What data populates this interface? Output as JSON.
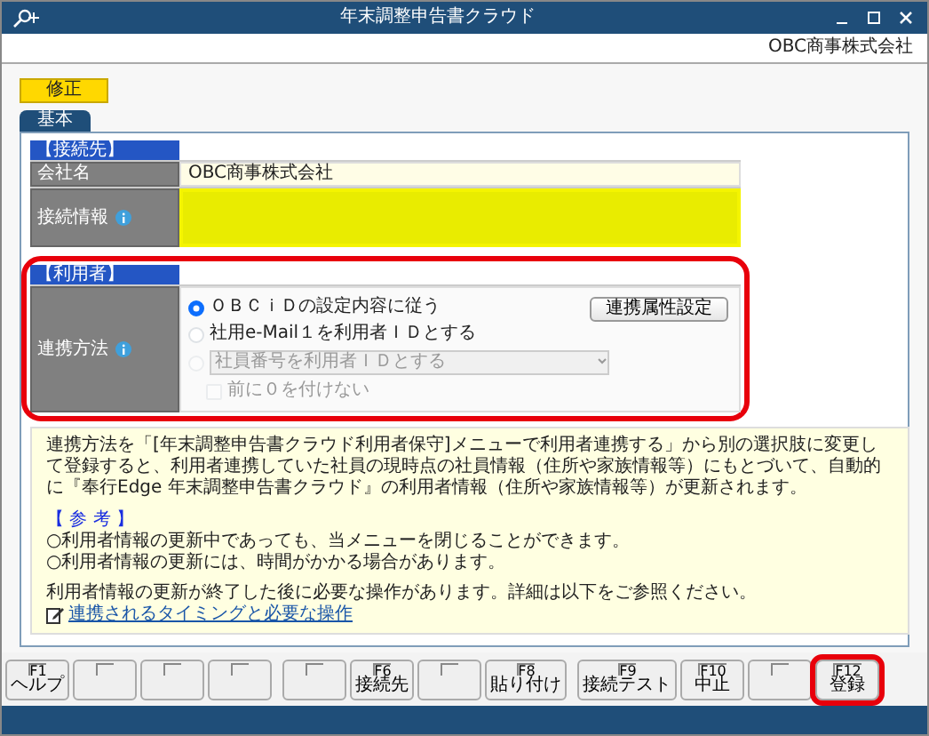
{
  "window": {
    "title": "年末調整申告書クラウド"
  },
  "company": "OBC商事株式会社",
  "mode_badge": "修正",
  "tabs": [
    {
      "label": "基本",
      "selected": true
    }
  ],
  "sections": [
    {
      "heading": "【接続先】",
      "highlighted": false,
      "rows": [
        {
          "kind": "text",
          "label": "会社名",
          "value": "OBC商事株式会社"
        },
        {
          "kind": "masked",
          "label": "接続情報",
          "info": true
        }
      ]
    },
    {
      "heading": "【利用者】",
      "highlighted": true,
      "rows": [
        {
          "kind": "options",
          "label": "連携方法",
          "info": true,
          "button": "連携属性設定",
          "options": [
            {
              "kind": "radio",
              "label": "ＯＢＣｉＤの設定内容に従う",
              "selected": true,
              "disabled": false
            },
            {
              "kind": "radio",
              "label": "社用e-Mail１を利用者ＩＤとする",
              "selected": false,
              "disabled": false
            },
            {
              "kind": "select",
              "label": "社員番号を利用者ＩＤとする",
              "selected": false,
              "disabled": true
            }
          ],
          "checkbox": {
            "label": "前に０を付けない",
            "checked": false,
            "disabled": true
          }
        }
      ]
    }
  ],
  "note": {
    "paragraph": "連携方法を「[年末調整申告書クラウド利用者保守]メニューで利用者連携する」から別の選択肢に変更して登録すると、利用者連携していた社員の現時点の社員情報（住所や家族情報等）にもとづいて、自動的に『奉行Edge 年末調整申告書クラウド』の利用者情報（住所や家族情報等）が更新されます。",
    "reference_heading": "【 参 考 】",
    "reference_items": [
      "○利用者情報の更新中であっても、当メニューを閉じることができます。",
      "○利用者情報の更新には、時間がかかる場合があります。"
    ],
    "closing": "利用者情報の更新が終了した後に必要な操作があります。詳細は以下をご参照ください。",
    "link": "連携されるタイミングと必要な操作"
  },
  "function_key_groups": [
    [
      {
        "key": "F1",
        "label": "ヘルプ",
        "highlighted": false
      },
      {
        "highlighted": false
      },
      {
        "highlighted": false
      },
      {
        "highlighted": false
      }
    ],
    [
      {
        "highlighted": false
      },
      {
        "key": "F6",
        "label": "接続先",
        "highlighted": false
      },
      {
        "highlighted": false
      },
      {
        "key": "F8",
        "label": "貼り付け",
        "highlighted": false
      }
    ],
    [
      {
        "key": "F9",
        "label": "接続テスト",
        "highlighted": false
      },
      {
        "key": "F10",
        "label": "中止",
        "highlighted": false
      },
      {
        "highlighted": false
      },
      {
        "key": "F12",
        "label": "登録",
        "highlighted": true
      }
    ]
  ]
}
